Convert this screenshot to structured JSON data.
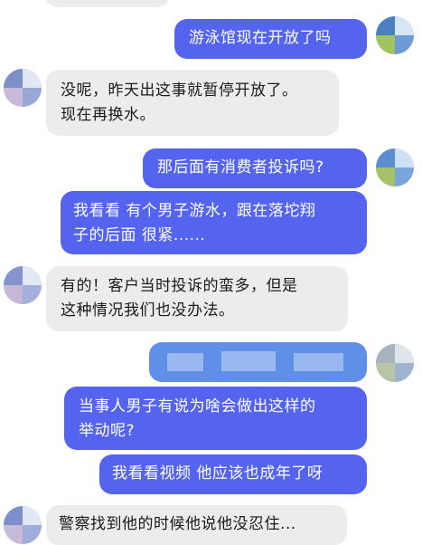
{
  "conversation": {
    "messages": [
      {
        "id": "m0",
        "side": "in",
        "text": ""
      },
      {
        "id": "m1",
        "side": "out",
        "text": "游泳馆现在开放了吗"
      },
      {
        "id": "m2",
        "side": "in",
        "lines": [
          "没呢，昨天出这事就暂停开放了。",
          "现在再换水。"
        ]
      },
      {
        "id": "m3",
        "side": "out",
        "text": "那后面有消费者投诉吗?"
      },
      {
        "id": "m4",
        "side": "out",
        "lines": [
          "我看看 有个男子游水，跟在落坨翔",
          "子的后面 很紧......"
        ]
      },
      {
        "id": "m5",
        "side": "in",
        "lines": [
          "有的！客户当时投诉的蛮多，但是",
          "这种情况我们也没办法。"
        ]
      },
      {
        "id": "m6",
        "side": "out",
        "text": "",
        "blurred": true
      },
      {
        "id": "m7",
        "side": "out",
        "lines": [
          "当事人男子有说为啥会做出这样的",
          "举动呢?"
        ]
      },
      {
        "id": "m8",
        "side": "out",
        "text": "我看看视频 他应该也成年了呀"
      },
      {
        "id": "m9",
        "side": "in",
        "text": "警察找到他的时候他说他没忍住..."
      }
    ]
  },
  "colors": {
    "outgoing_bubble": "#5564ee",
    "incoming_bubble": "#ececee",
    "outgoing_text": "#ffffff",
    "incoming_text": "#1a1a1a",
    "blurred_bubble": "#5f8fe6"
  }
}
